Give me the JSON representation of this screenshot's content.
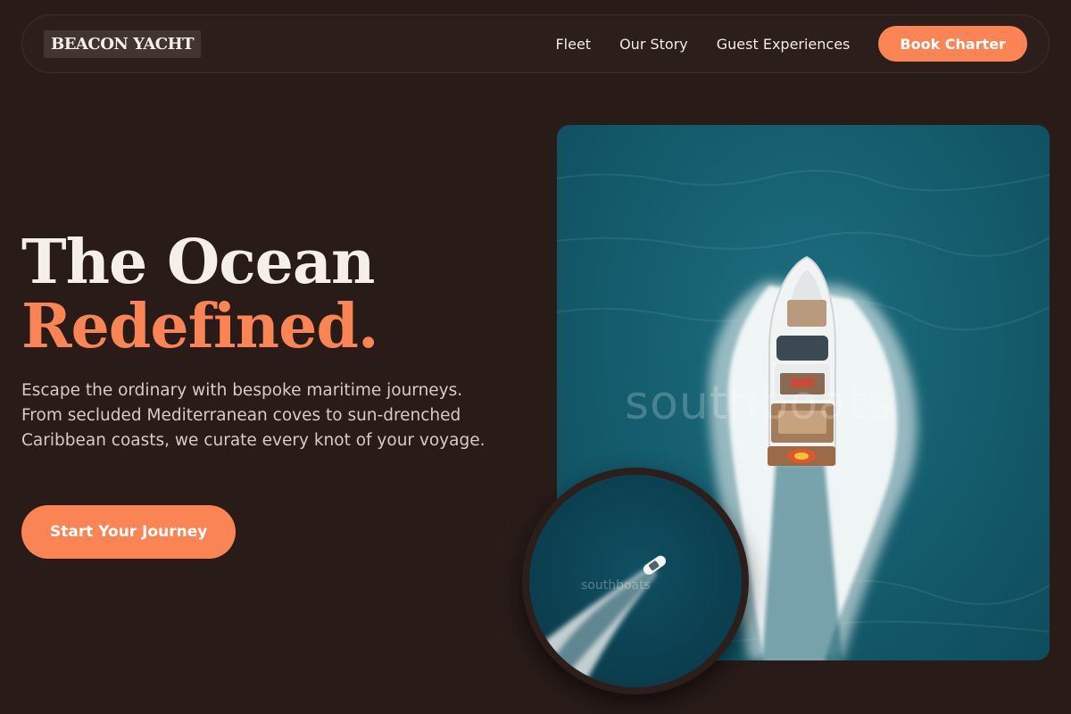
{
  "nav": {
    "logo": "BEACON YACHT",
    "links": [
      "Fleet",
      "Our Story",
      "Guest Experiences"
    ],
    "cta": "Book Charter"
  },
  "hero": {
    "title_line1": "The Ocean",
    "title_line2": "Redefined.",
    "description": "Escape the ordinary with bespoke maritime journeys. From secluded Mediterranean coves to sun-drenched Caribbean coasts, we curate every knot of your voyage.",
    "cta": "Start Your Journey"
  },
  "images": {
    "main_watermark": "southboats",
    "inset_watermark": "southboats"
  },
  "colors": {
    "background": "#281b18",
    "accent": "#fb8454",
    "text": "#f3ebe6",
    "muted_text": "#d7cbc4",
    "water": "#155f70"
  }
}
